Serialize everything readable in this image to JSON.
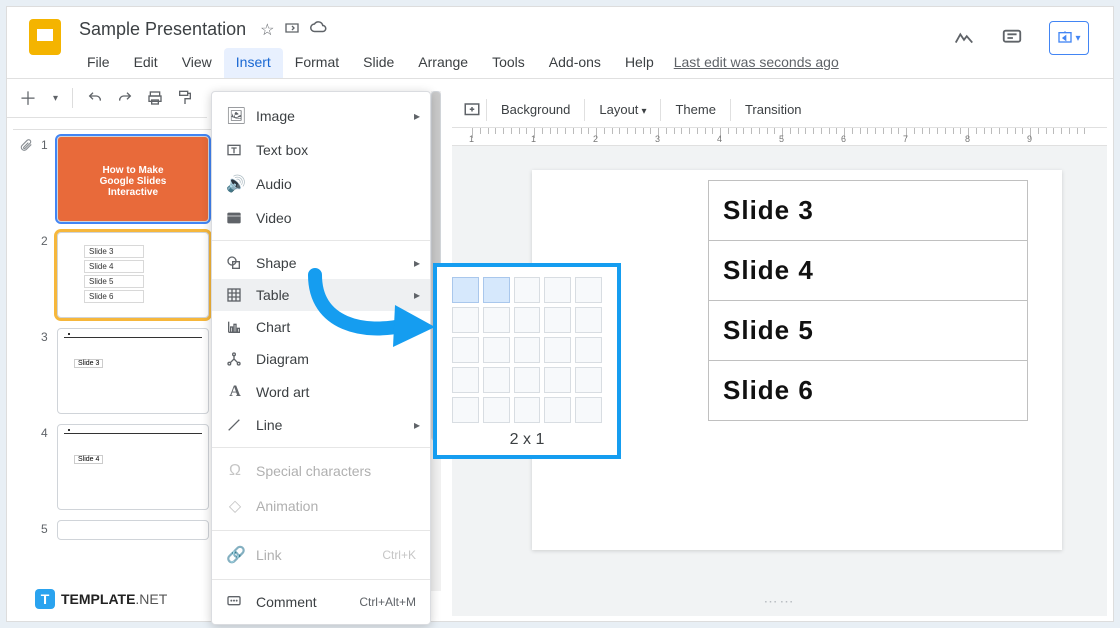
{
  "doc_title": "Sample Presentation",
  "last_edit": "Last edit was seconds ago",
  "menubar": {
    "file": "File",
    "edit": "Edit",
    "view": "View",
    "insert": "Insert",
    "format": "Format",
    "slide": "Slide",
    "arrange": "Arrange",
    "tools": "Tools",
    "addons": "Add-ons",
    "help": "Help"
  },
  "insert_menu": {
    "image": "Image",
    "textbox": "Text box",
    "audio": "Audio",
    "video": "Video",
    "shape": "Shape",
    "table": "Table",
    "chart": "Chart",
    "diagram": "Diagram",
    "wordart": "Word art",
    "line": "Line",
    "special": "Special characters",
    "animation": "Animation",
    "link": "Link",
    "link_shortcut": "Ctrl+K",
    "comment": "Comment",
    "comment_shortcut": "Ctrl+Alt+M"
  },
  "table_popup": {
    "dims": "2 x 1"
  },
  "canvas_bar": {
    "background": "Background",
    "layout": "Layout",
    "theme": "Theme",
    "transition": "Transition"
  },
  "ruler_labels": [
    "1",
    "1",
    "2",
    "3",
    "4",
    "5",
    "6",
    "7",
    "8",
    "9"
  ],
  "table_rows": [
    "Slide 3",
    "Slide 4",
    "Slide 5",
    "Slide 6"
  ],
  "thumbnail1": {
    "l1": "How to Make",
    "l2": "Google Slides",
    "l3": "Interactive"
  },
  "thumbnail2_rows": [
    "Slide 3",
    "Slide 4",
    "Slide 5",
    "Slide 6"
  ],
  "thumbnail3_label": "Slide 3",
  "thumbnail4_label": "Slide 4",
  "watermark": {
    "t": "T",
    "brand": "TEMPLATE",
    "net": ".NET"
  }
}
